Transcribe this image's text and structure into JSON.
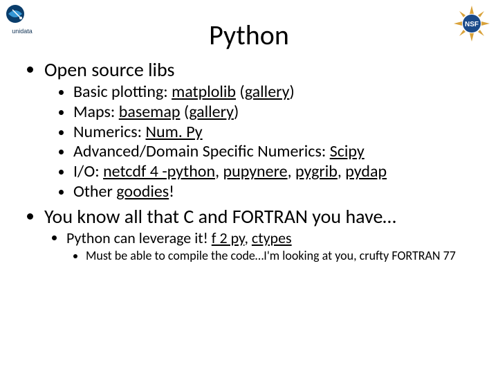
{
  "title": "Python",
  "b1": {
    "text": "Open source libs",
    "sub": [
      {
        "pre": "Basic plotting: ",
        "l1": "matplolib",
        "l2": "gallery"
      },
      {
        "pre": "Maps: ",
        "l1": "basemap",
        "l2": "gallery"
      },
      {
        "pre": "Numerics: ",
        "l1": "Num. Py"
      },
      {
        "pre": "Advanced/Domain Specific Numerics: ",
        "l1": "Scipy"
      },
      {
        "pre": "I/O: ",
        "l1": "netcdf 4 -python",
        "l2": "pupynere",
        "l3": "pygrib",
        "l4": "pydap"
      },
      {
        "pre": "Other ",
        "l1": "goodies",
        "post": "!"
      }
    ]
  },
  "b2": {
    "text": "You know all that C and FORTRAN you have…",
    "sub": [
      {
        "pre": "Python can leverage it! ",
        "l1": "f 2 py",
        "l2": "ctypes",
        "sub": [
          "Must be able to compile the code…I'm looking at you, crufty FORTRAN 77"
        ]
      }
    ]
  }
}
